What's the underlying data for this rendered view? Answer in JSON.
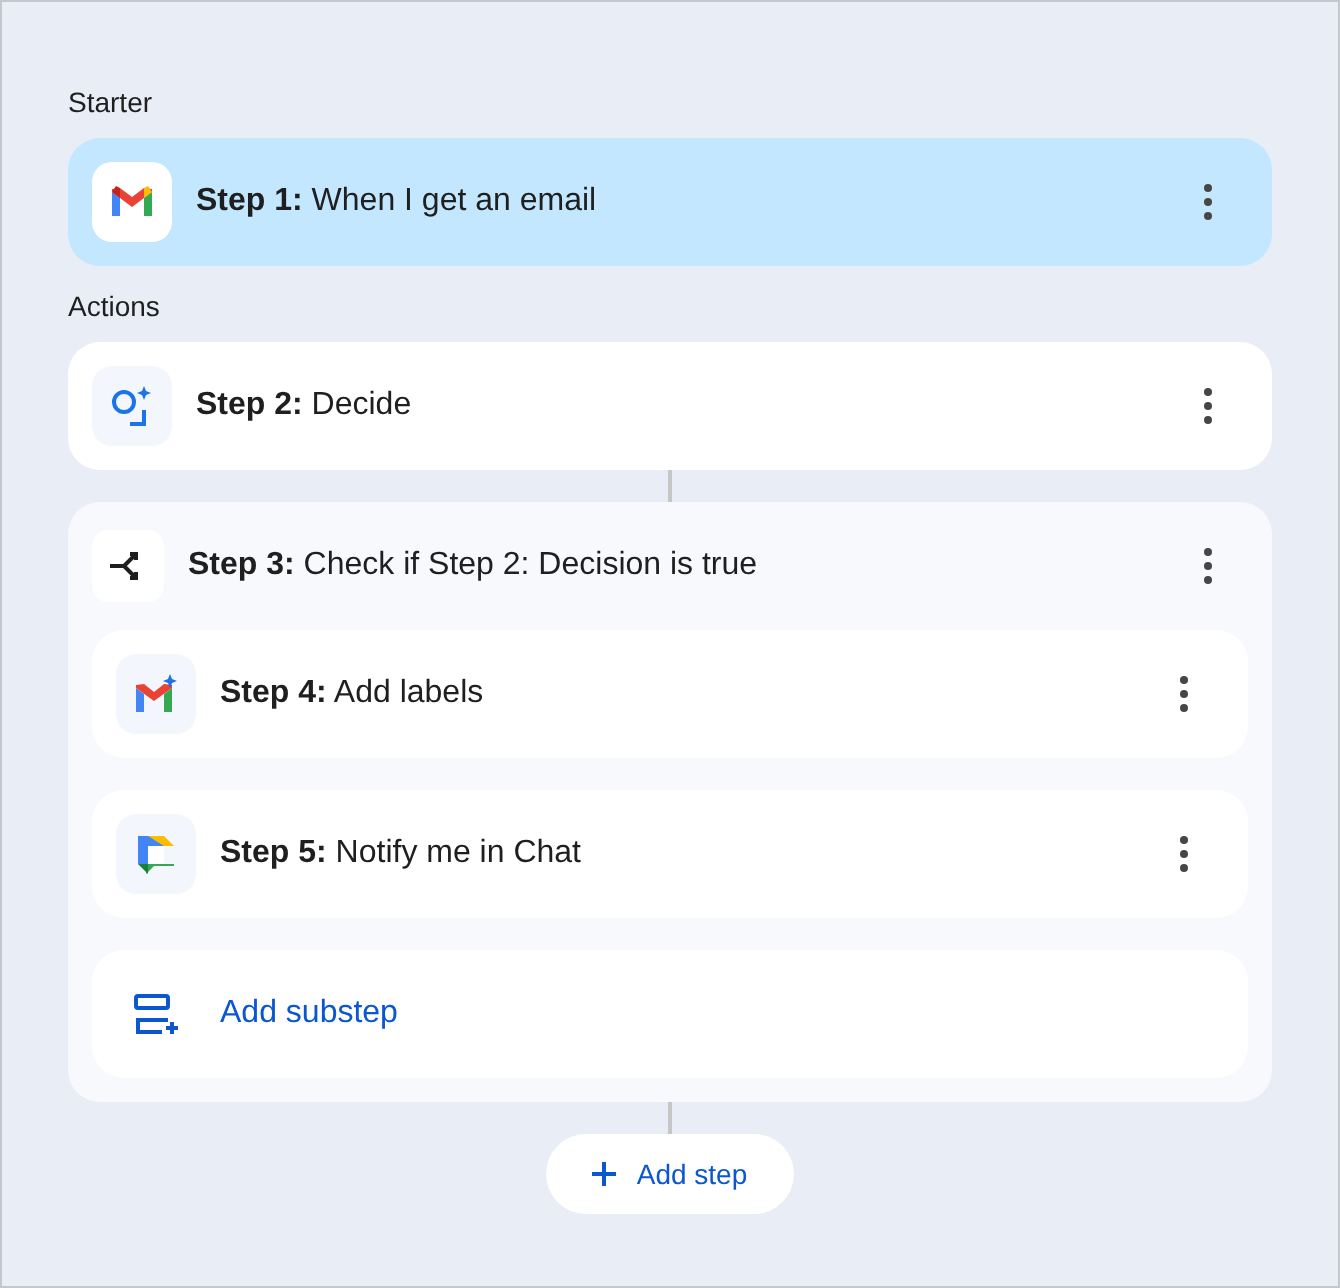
{
  "starter": {
    "heading": "Starter",
    "step": {
      "text": "**Step 1:** When I get an email",
      "selected": true
    }
  },
  "actions": {
    "heading": "Actions",
    "steps": [
      {
        "text": "**Step 2:** Decide",
        "selected": false
      },
      {
        "text": "**Step 3:** Check if Step 2: Decision is true",
        "selected": false,
        "children": [
          {
            "text": "**Step 4:** Add labels",
            "selected": false
          },
          {
            "text": "**Step 5:** Notify me in Chat",
            "selected": false
          }
        ],
        "add_substep": "Add substep"
      }
    ]
  },
  "add_step": "Add step"
}
